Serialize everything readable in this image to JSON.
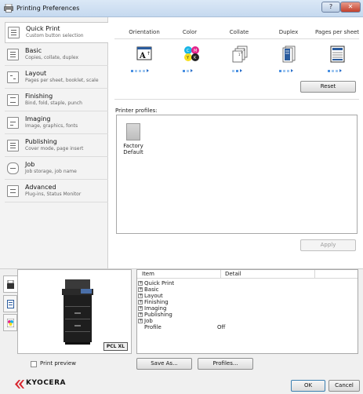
{
  "window": {
    "title": "Printing Preferences",
    "help_glyph": "?",
    "close_glyph": "✕"
  },
  "sidebar": {
    "items": [
      {
        "label": "Quick Print",
        "sub": "Custom button selection",
        "icon": "quick-print-icon",
        "selected": true
      },
      {
        "label": "Basic",
        "sub": "Copies, collate, duplex",
        "icon": "basic-icon"
      },
      {
        "label": "Layout",
        "sub": "Pages per sheet, booklet, scale",
        "icon": "layout-icon"
      },
      {
        "label": "Finishing",
        "sub": "Bind, fold, staple, punch",
        "icon": "finishing-icon"
      },
      {
        "label": "Imaging",
        "sub": "Image, graphics, fonts",
        "icon": "imaging-icon"
      },
      {
        "label": "Publishing",
        "sub": "Cover mode, page insert",
        "icon": "publishing-icon"
      },
      {
        "label": "Job",
        "sub": "Job storage, job name",
        "icon": "job-icon"
      },
      {
        "label": "Advanced",
        "sub": "Plug-ins, Status Monitor",
        "icon": "advanced-icon"
      }
    ]
  },
  "quick": {
    "columns": [
      "Orientation",
      "Color",
      "Collate",
      "Duplex",
      "Pages per sheet"
    ],
    "orientation_glyph": "A",
    "color_letters": [
      "C",
      "M",
      "Y",
      "K"
    ],
    "collate_numbers": [
      "1",
      "2",
      "3"
    ],
    "reset_label": "Reset",
    "profiles_label": "Printer profiles:",
    "profile_name_1": "Factory",
    "profile_name_2": "Default",
    "apply_label": "Apply"
  },
  "bottom": {
    "pcl_label": "PCL XL",
    "table_headers": [
      "Item",
      "Detail"
    ],
    "rows": [
      {
        "expand": "+",
        "item": "Quick Print",
        "detail": ""
      },
      {
        "expand": "+",
        "item": "Basic",
        "detail": ""
      },
      {
        "expand": "+",
        "item": "Layout",
        "detail": ""
      },
      {
        "expand": "+",
        "item": "Finishing",
        "detail": ""
      },
      {
        "expand": "+",
        "item": "Imaging",
        "detail": ""
      },
      {
        "expand": "+",
        "item": "Publishing",
        "detail": ""
      },
      {
        "expand": "+",
        "item": "Job",
        "detail": ""
      },
      {
        "expand": "",
        "item": "Profile",
        "detail": "Off"
      }
    ],
    "print_preview_label": "Print preview",
    "save_as_label": "Save As...",
    "profiles_button_label": "Profiles...",
    "ok_label": "OK",
    "cancel_label": "Cancel",
    "brand": "KYOCERA"
  },
  "colors": {
    "cyan": "#19b5e6",
    "magenta": "#e2268c",
    "yellow": "#f6df1e",
    "black": "#222222",
    "brand_red": "#d8262f"
  }
}
